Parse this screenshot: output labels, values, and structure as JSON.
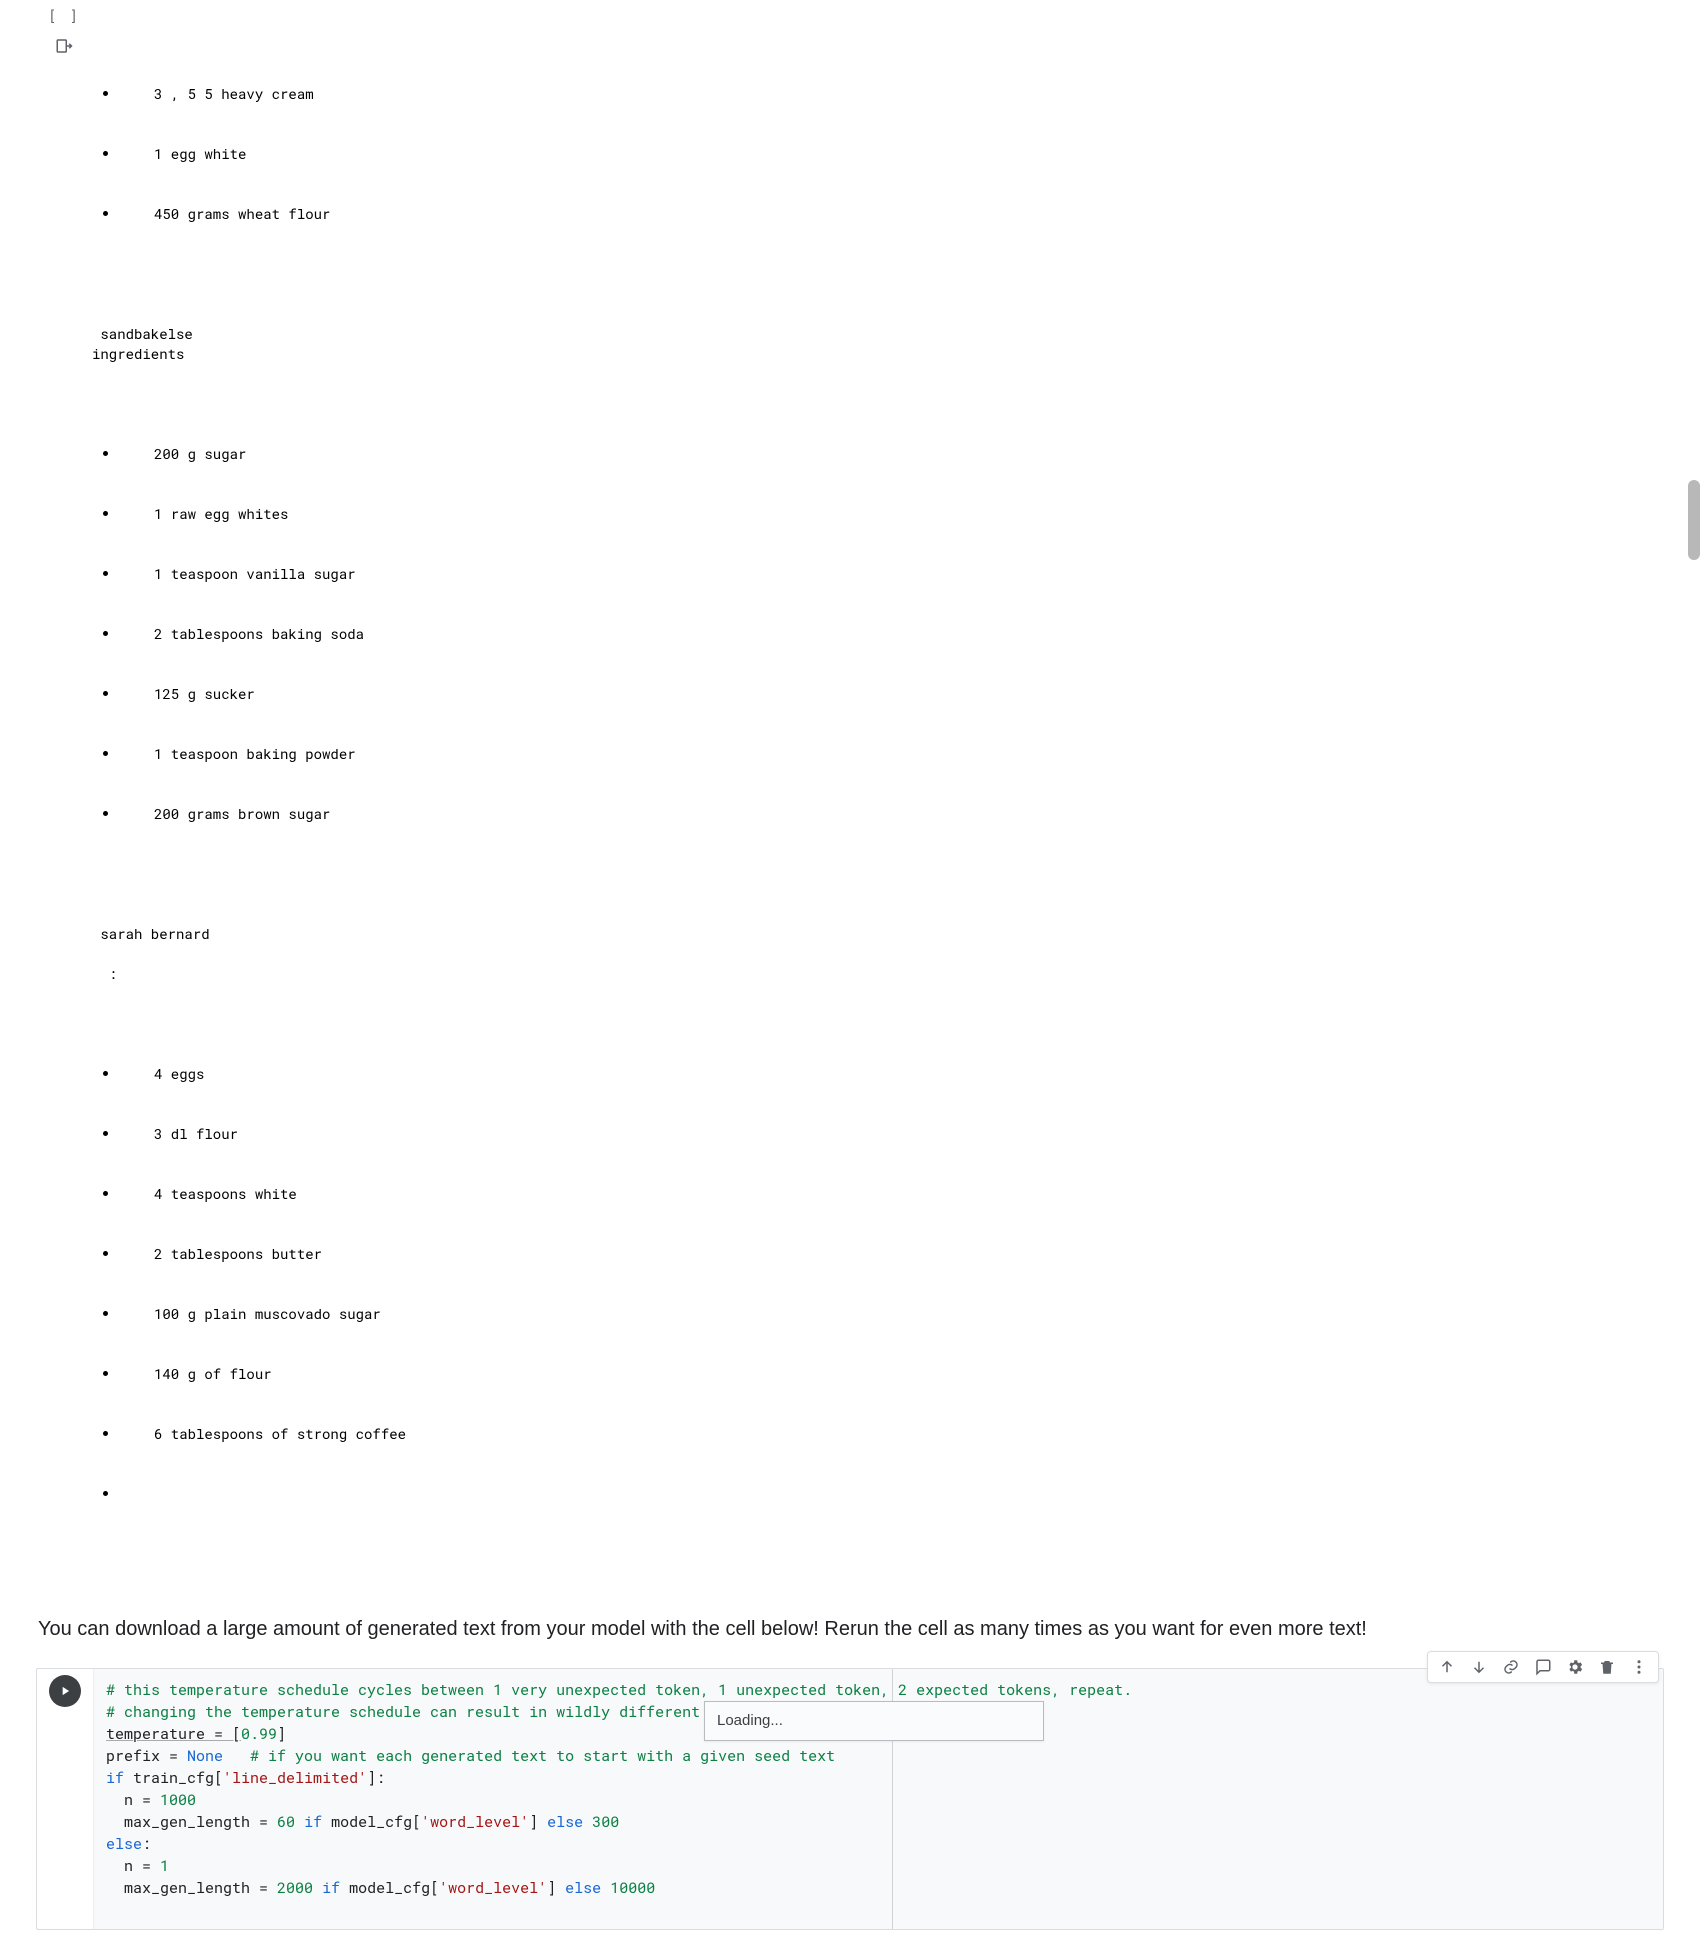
{
  "output": {
    "bracket_label": "[ ]",
    "top_items": [
      "3 , 5 5 heavy cream",
      "1 egg white",
      "450 grams wheat flour"
    ],
    "section1": {
      "title": " sandbakelse",
      "subtitle": "ingredients",
      "items": [
        "200 g sugar",
        "1 raw egg whites",
        "1 teaspoon vanilla sugar",
        "2 tablespoons baking soda",
        "125 g sucker",
        "1 teaspoon baking powder",
        "200 grams brown sugar"
      ]
    },
    "section2": {
      "title": " sarah bernard",
      "subtitle": "  :",
      "items": [
        "4 eggs",
        "3 dl flour",
        "4 teaspoons white",
        "2 tablespoons butter",
        "100 g plain muscovado sugar",
        "140 g of flour",
        "6 tablespoons of strong coffee",
        ""
      ]
    }
  },
  "text_cell": "You can download a large amount of generated text from your model with the cell below! Rerun the cell as many times as you want for even more text!",
  "tooltip": "Loading...",
  "code": {
    "l1": "# this temperature schedule cycles between 1 very unexpected token, 1 unexpected token, 2 expected tokens, repeat.",
    "l2": "# changing the temperature schedule can result in wildly different output!",
    "l3a": "temperature = [",
    "l3b": "0.99",
    "l3c": "]",
    "l4a": "prefix = ",
    "l4b": "None",
    "l4c": "   ",
    "l4d": "# if you want each generated text to start with a given seed text",
    "l5": "",
    "l6a": "if",
    "l6b": " train_cfg[",
    "l6c": "'line_delimited'",
    "l6d": "]:",
    "l7a": "  n = ",
    "l7b": "1000",
    "l8a": "  max_gen_length = ",
    "l8b": "60",
    "l8c": " ",
    "l8d": "if",
    "l8e": " model_cfg[",
    "l8f": "'word_level'",
    "l8g": "] ",
    "l8h": "else",
    "l8i": " ",
    "l8j": "300",
    "l9a": "else",
    "l9b": ":",
    "l10a": "  n = ",
    "l10b": "1",
    "l11a": "  max_gen_length = ",
    "l11b": "2000",
    "l11c": " ",
    "l11d": "if",
    "l11e": " model_cfg[",
    "l11f": "'word_level'",
    "l11g": "] ",
    "l11h": "else",
    "l11i": " ",
    "l11j": "10000"
  },
  "toolbar": {
    "move_up": "Move up",
    "move_down": "Move down",
    "link": "Link",
    "comment": "Comment",
    "settings": "Settings",
    "delete": "Delete",
    "more": "More"
  }
}
